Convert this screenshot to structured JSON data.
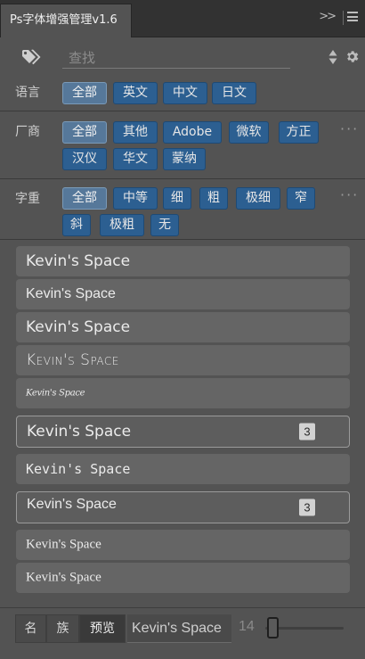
{
  "window": {
    "title": "Ps字体增强管理v1.6"
  },
  "search": {
    "placeholder": "查找"
  },
  "filters": [
    {
      "label": "语言",
      "chips": [
        {
          "text": "全部",
          "active": true
        },
        {
          "text": "英文"
        },
        {
          "text": "中文"
        },
        {
          "text": "日文"
        }
      ]
    },
    {
      "label": "厂商",
      "chips": [
        {
          "text": "全部",
          "active": true
        },
        {
          "text": "其他"
        },
        {
          "text": "Adobe"
        },
        {
          "text": "微软"
        },
        {
          "text": "方正"
        },
        {
          "text": "汉仪"
        },
        {
          "text": "华文"
        },
        {
          "text": "蒙纳"
        }
      ]
    },
    {
      "label": "字重",
      "chips": [
        {
          "text": "全部",
          "active": true
        },
        {
          "text": "中等"
        },
        {
          "text": "细"
        },
        {
          "text": "粗"
        },
        {
          "text": "极细"
        },
        {
          "text": "窄"
        },
        {
          "text": "斜"
        },
        {
          "text": "极粗"
        },
        {
          "text": "无"
        }
      ]
    }
  ],
  "fonts": [
    {
      "text": "Kevin's Space",
      "style": "sans-large"
    },
    {
      "text": "Kevin's Space",
      "style": "sans"
    },
    {
      "text": "Kevin's Space",
      "style": "sans-large"
    },
    {
      "text": "Kevin's Space",
      "style": "smallcaps"
    },
    {
      "text": "Kevin's Space",
      "style": "script"
    },
    {
      "text": "Kevin's Space",
      "style": "sans-large",
      "selected": true,
      "count": "3"
    },
    {
      "text": "Kevin's Space",
      "style": "mono"
    },
    {
      "text": "Kevin's Space",
      "style": "sans-light",
      "selected": true,
      "count": "3"
    },
    {
      "text": "Kevin's Space",
      "style": "serif"
    },
    {
      "text": "Kevin's Space",
      "style": "serif"
    }
  ],
  "bottom": {
    "modes": [
      "名",
      "族",
      "预览"
    ],
    "active_mode": "预览",
    "preview_text": "Kevin's Space",
    "size": "14"
  }
}
